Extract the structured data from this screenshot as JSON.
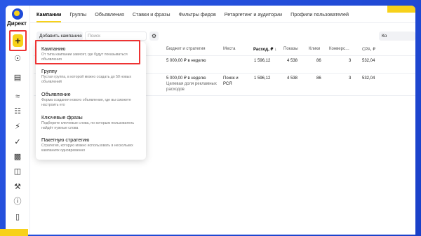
{
  "app": {
    "brand": "Директ"
  },
  "colors": {
    "accent": "#f7d11a",
    "highlight": "#e33333",
    "background": "#1f4bd8"
  },
  "tabs": [
    {
      "label": "Кампании",
      "active": true
    },
    {
      "label": "Группы"
    },
    {
      "label": "Объявления"
    },
    {
      "label": "Ставки и фразы"
    },
    {
      "label": "Фильтры фидов"
    },
    {
      "label": "Ретаргетинг и аудитории"
    },
    {
      "label": "Профили пользователей"
    }
  ],
  "toolbar": {
    "add_campaign": "Добавить кампанию",
    "search_placeholder": "Поиск",
    "columns_label": "Ко"
  },
  "table": {
    "headers": {
      "budget": "Бюджет и стратегия",
      "places": "Места",
      "spend": "Расход, ₽ ↓",
      "impressions": "Показы",
      "clicks": "Клики",
      "conversions": "Конверс…",
      "cpa": "CPA, ₽"
    },
    "rows": [
      {
        "budget": "5 000,00 ₽ в неделю",
        "budget_sub": "",
        "places": "",
        "spend": "1 596,12",
        "impressions": "4 538",
        "clicks": "86",
        "conversions": "3",
        "cpa": "532,04"
      },
      {
        "budget": "5 000,00 ₽ в неделю",
        "budget_sub": "Целевая доля рекламных расходов",
        "places": "Поиск и РСЯ",
        "spend": "1 596,12",
        "impressions": "4 538",
        "clicks": "86",
        "conversions": "3",
        "cpa": "532,04"
      }
    ]
  },
  "dropdown": {
    "items": [
      {
        "title": "Кампанию",
        "desc": "От типа кампании зависит, где будут показываться объявления"
      },
      {
        "title": "Группу",
        "desc": "Пустая группа, в которой можно создать до 50 новых объявлений"
      },
      {
        "title": "Объявление",
        "desc": "Форма создания нового объявления, где вы сможете настроить его"
      },
      {
        "title": "Ключевые фразы",
        "desc": "Подберите ключевые слова, по которым пользователь найдёт нужные слова"
      },
      {
        "title": "Пакетную стратегию",
        "desc": "Стратегия, которую можно использовать в нескольких кампаниях одновременно"
      }
    ]
  },
  "rail_icons": [
    "user-icon",
    "wallet-icon",
    "waves-icon",
    "list-icon",
    "lightning-icon",
    "check-circle-icon",
    "bar-chart-icon",
    "apps-icon",
    "wrench-icon",
    "info-icon",
    "folder-icon"
  ]
}
